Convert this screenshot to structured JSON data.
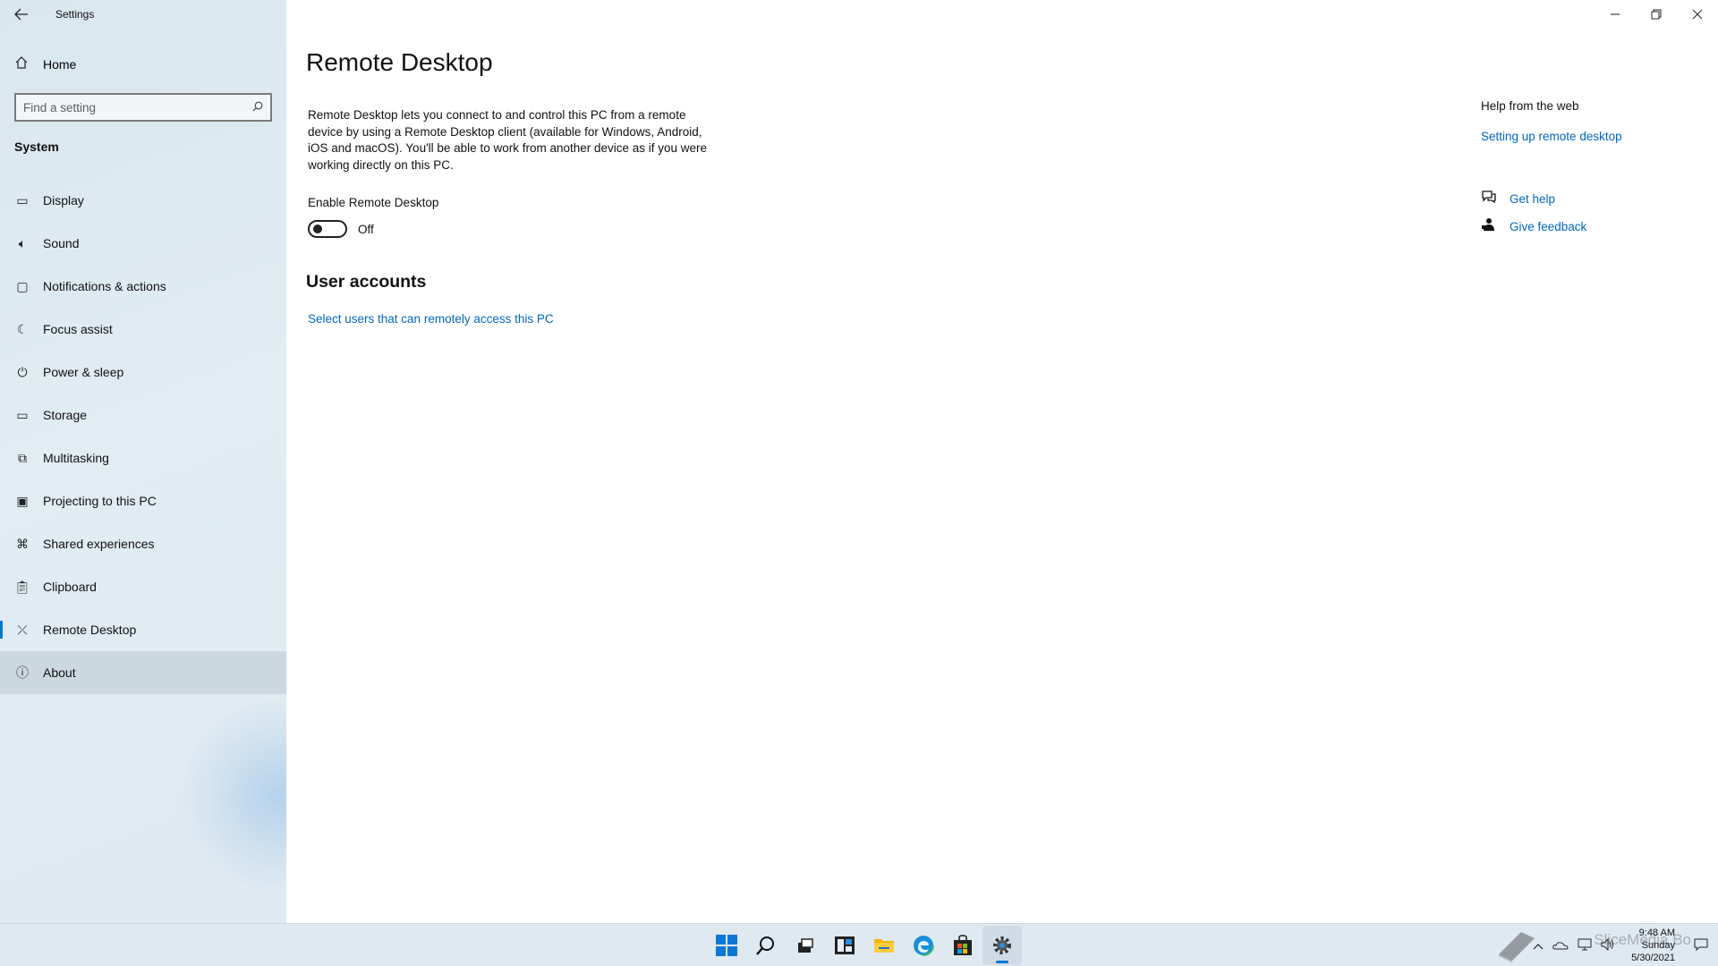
{
  "window": {
    "app_title": "Settings",
    "controls": {
      "minimize": "—",
      "restore": "❐",
      "close": "✕"
    }
  },
  "sidebar": {
    "home_label": "Home",
    "search_placeholder": "Find a setting",
    "section": "System",
    "items": [
      {
        "label": "Display",
        "icon": "monitor-icon",
        "glyph": "▭"
      },
      {
        "label": "Sound",
        "icon": "speaker-icon",
        "glyph": "🔈︎"
      },
      {
        "label": "Notifications & actions",
        "icon": "notification-icon",
        "glyph": "▢"
      },
      {
        "label": "Focus assist",
        "icon": "moon-icon",
        "glyph": "☾"
      },
      {
        "label": "Power & sleep",
        "icon": "power-icon",
        "glyph": "⏻"
      },
      {
        "label": "Storage",
        "icon": "storage-icon",
        "glyph": "▭"
      },
      {
        "label": "Multitasking",
        "icon": "multitasking-icon",
        "glyph": "⧉"
      },
      {
        "label": "Projecting to this PC",
        "icon": "projecting-icon",
        "glyph": "▣"
      },
      {
        "label": "Shared experiences",
        "icon": "shared-experiences-icon",
        "glyph": "⌘"
      },
      {
        "label": "Clipboard",
        "icon": "clipboard-icon",
        "glyph": "📋︎"
      },
      {
        "label": "Remote Desktop",
        "icon": "remote-desktop-icon",
        "glyph": "⤫"
      },
      {
        "label": "About",
        "icon": "info-icon",
        "glyph": "ⓘ"
      }
    ],
    "selected_index": 10,
    "hover_index": 11
  },
  "main": {
    "title": "Remote Desktop",
    "description": "Remote Desktop lets you connect to and control this PC from a remote device by using a Remote Desktop client (available for Windows, Android, iOS and macOS). You'll be able to work from another device as if you were working directly on this PC.",
    "toggle_label": "Enable Remote Desktop",
    "toggle_state": "Off",
    "toggle_on": false,
    "user_accounts_heading": "User accounts",
    "users_link": "Select users that can remotely access this PC"
  },
  "help": {
    "title": "Help from the web",
    "web_link": "Setting up remote desktop",
    "get_help": "Get help",
    "give_feedback": "Give feedback"
  },
  "taskbar": {
    "apps": [
      "start-icon",
      "search-icon",
      "task-view-icon",
      "widgets-icon",
      "file-explorer-icon",
      "edge-icon",
      "store-icon",
      "settings-icon"
    ],
    "active_app": "settings-icon",
    "time": "9:48 AM",
    "day": "Sunday",
    "date": "5/30/2021",
    "watermark": "SliceMedia Bo"
  },
  "colors": {
    "accent": "#0078d4",
    "link": "#0067c0",
    "sidebar_bg": "#dfeaf2",
    "taskbar_bg": "#dfe9f2"
  }
}
